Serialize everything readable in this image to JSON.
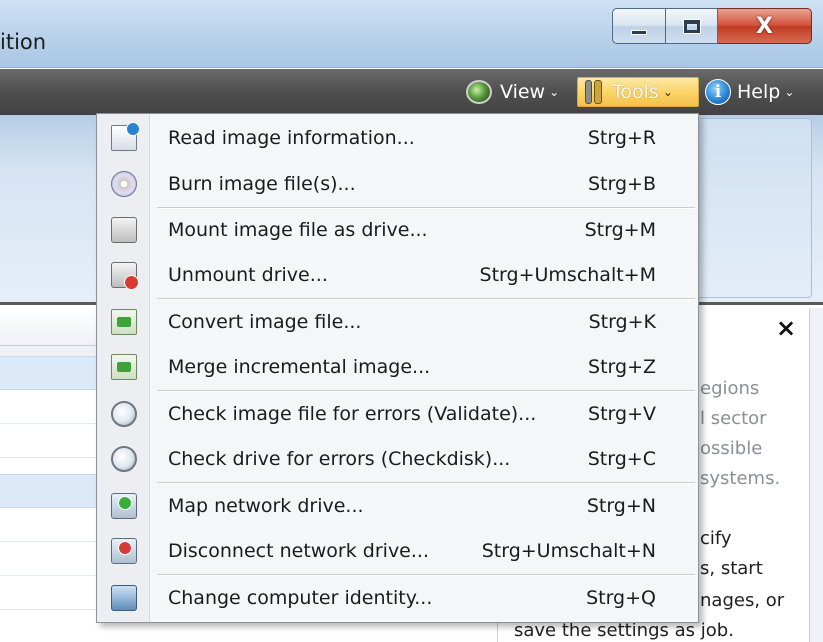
{
  "window": {
    "title_fragment": "ition",
    "controls": [
      "minimize",
      "maximize",
      "close"
    ]
  },
  "toolbar": {
    "view_label": "View",
    "tools_label": "Tools",
    "help_label": "Help",
    "help_icon_glyph": "i",
    "chevron": "⌄"
  },
  "info_panel": {
    "close_glyph": "×",
    "lines": [
      "egions",
      "l sector",
      "ossible",
      "systems.",
      "cify",
      "s, start",
      "nages, or",
      "save the settings as job."
    ]
  },
  "menu": {
    "items": [
      {
        "label": "Read image information...",
        "shortcut": "Strg+R",
        "icon": "document-info-icon"
      },
      {
        "label": "Burn image file(s)...",
        "shortcut": "Strg+B",
        "icon": "disc-burn-icon"
      },
      {
        "label": "Mount image file as drive...",
        "shortcut": "Strg+M",
        "icon": "mount-drive-icon"
      },
      {
        "label": "Unmount drive...",
        "shortcut": "Strg+Umschalt+M",
        "icon": "unmount-drive-icon"
      },
      {
        "label": "Convert image file...",
        "shortcut": "Strg+K",
        "icon": "convert-icon"
      },
      {
        "label": "Merge incremental image...",
        "shortcut": "Strg+Z",
        "icon": "merge-icon"
      },
      {
        "label": "Check image file for errors (Validate)...",
        "shortcut": "Strg+V",
        "icon": "validate-icon"
      },
      {
        "label": "Check drive for errors (Checkdisk)...",
        "shortcut": "Strg+C",
        "icon": "checkdisk-icon"
      },
      {
        "label": "Map network drive...",
        "shortcut": "Strg+N",
        "icon": "map-network-drive-icon"
      },
      {
        "label": "Disconnect network drive...",
        "shortcut": "Strg+Umschalt+N",
        "icon": "disconnect-network-drive-icon"
      },
      {
        "label": "Change computer identity...",
        "shortcut": "Strg+Q",
        "icon": "computer-identity-icon"
      }
    ]
  },
  "colors": {
    "toolbar_bg": "#4f4f4f",
    "tools_highlight": "#fbd46a",
    "close_button": "#c13a23",
    "menu_bg": "#f5f6f7",
    "selection_row": "#dbe9f8"
  }
}
